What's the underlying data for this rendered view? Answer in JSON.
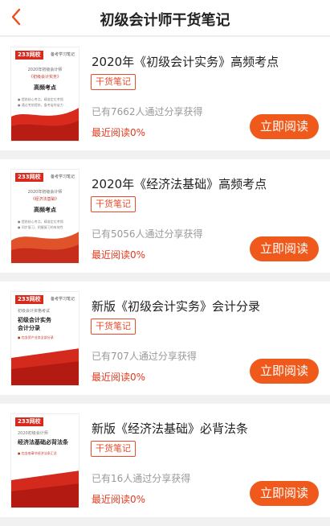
{
  "header": {
    "title": "初级会计师干货笔记",
    "back_icon": "chevron-left-icon",
    "accent": "#ef5a1c"
  },
  "items": [
    {
      "title": "2020年《初级会计实务》高频考点",
      "badge": "干货笔记",
      "shares": "已有7662人通过分享获得",
      "recent": "最近阅读0%",
      "button": "立即阅读",
      "cover": {
        "brand": "233网校",
        "tag": "备考学习笔记",
        "line1": "2020年初级会计师",
        "line2": "《初级会计实务》",
        "line3": "高频考点",
        "bullet1": "● 提炼核心考点，精准定位考频",
        "bullet2": "● 通过考前提炼，备考省时省力"
      }
    },
    {
      "title": "2020年《经济法基础》高频考点",
      "badge": "干货笔记",
      "shares": "已有5056人通过分享获得",
      "recent": "最近阅读0%",
      "button": "立即阅读",
      "cover": {
        "brand": "233网校",
        "tag": "备考学习笔记",
        "line1": "2020年初级会计师",
        "line2": "《经济法基础》",
        "line3": "高频考点",
        "bullet1": "● 提炼核心考点，精准定位考频",
        "bullet2": "● 同步复习，把握复习的有效性"
      }
    },
    {
      "title": "新版《初级会计实务》会计分录",
      "badge": "干货笔记",
      "shares": "已有707人通过分享获得",
      "recent": "最近阅读0%",
      "button": "立即阅读",
      "cover": {
        "brand": "233网校",
        "tag": "备考学习笔记",
        "line1": "初级会计资格考试",
        "line2": "初级会计实务",
        "line3": "会计分录",
        "bullet1": "● 包含资产业务全部分录",
        "bullet2": ""
      }
    },
    {
      "title": "新版《经济法基础》必背法条",
      "badge": "干货笔记",
      "shares": "已有16人通过分享获得",
      "recent": "最近阅读0%",
      "button": "立即阅读",
      "cover": {
        "brand": "233网校",
        "tag": "",
        "line1": "2020初级会计师",
        "line2": "经济法基础必背法条",
        "line3": "",
        "bullet1": "● 包含各章节经济法条汇总",
        "bullet2": ""
      }
    }
  ]
}
